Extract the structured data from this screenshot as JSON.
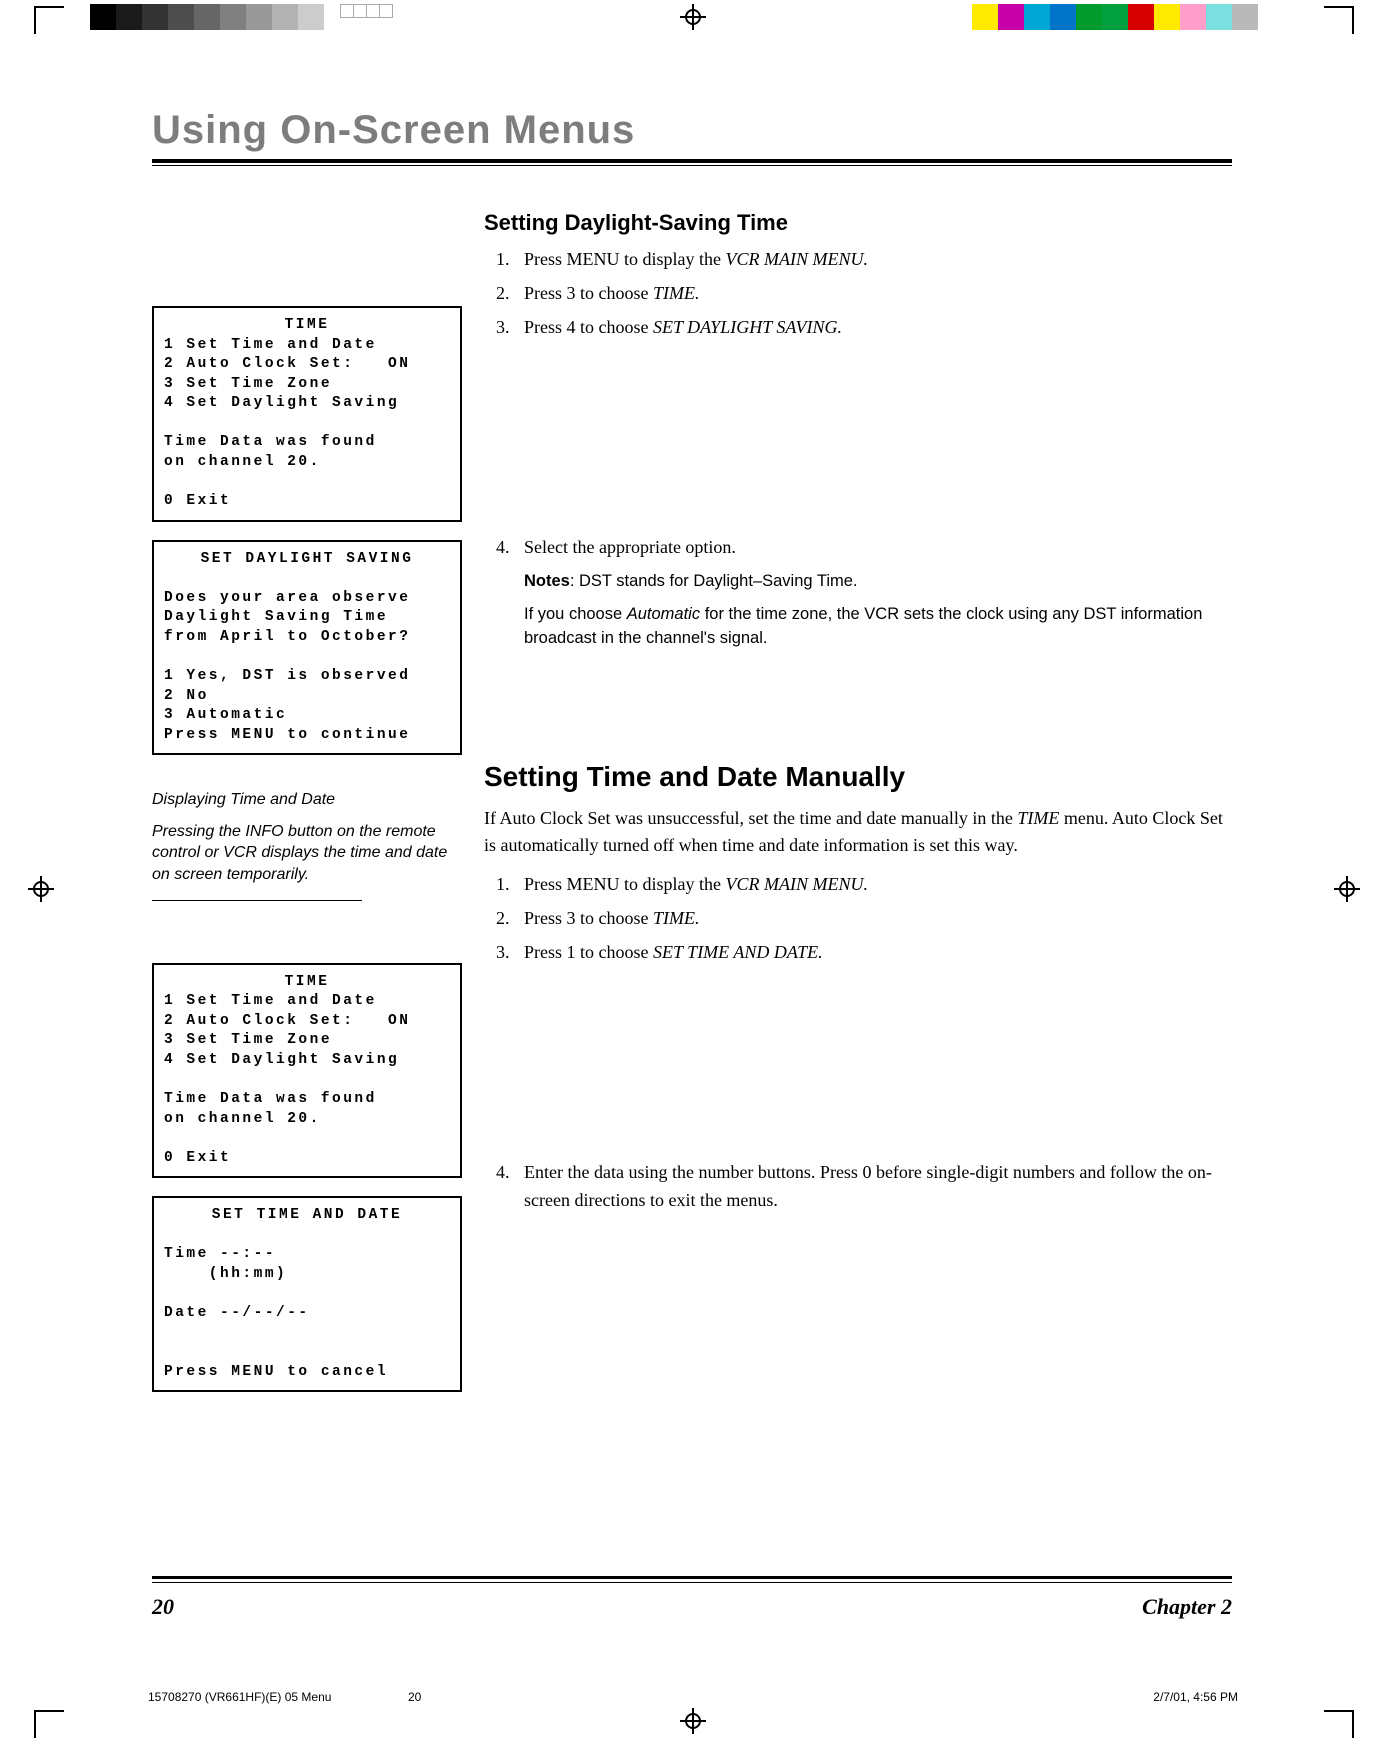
{
  "page_title": "Using On-Screen Menus",
  "section1": {
    "heading": "Setting Daylight-Saving Time",
    "step1a": "Press MENU to display the ",
    "step1b": "VCR MAIN MENU.",
    "step2a": "Press 3 to choose ",
    "step2b": "TIME.",
    "step3a": "Press 4 to choose ",
    "step3b": "SET DAYLIGHT SAVING.",
    "step4": "Select the appropriate option.",
    "notes_label": "Notes",
    "notes_a": ": DST stands for Daylight–Saving Time.",
    "notes_b1": "If you choose ",
    "notes_b2": "Automatic",
    "notes_b3": " for the time zone, the VCR sets the clock using any DST information broadcast in the channel's signal."
  },
  "sidebar_note": {
    "heading": "Displaying Time and Date",
    "body": "Pressing the INFO button on the remote control or VCR displays the time and date on screen temporarily."
  },
  "section2": {
    "heading": "Setting Time and Date Manually",
    "intro1": "If Auto Clock Set was unsuccessful, set the time and date manually in the ",
    "intro2": "TIME",
    "intro3": " menu. Auto Clock Set is automatically turned off when time and date information is set this way.",
    "step1a": "Press MENU to display the ",
    "step1b": "VCR MAIN MENU.",
    "step2a": "Press 3 to choose ",
    "step2b": "TIME.",
    "step3a": "Press 1 to choose ",
    "step3b": "SET TIME AND DATE.",
    "step4": "Enter the data using the number buttons. Press 0 before single-digit numbers and follow the on-screen directions to exit the menus."
  },
  "osd_time_title": "TIME",
  "osd_time_body": "1 Set Time and Date\n2 Auto Clock Set:   ON\n3 Set Time Zone\n4 Set Daylight Saving\n\nTime Data was found\non channel 20.\n\n0 Exit",
  "osd_dst_title": "SET DAYLIGHT SAVING",
  "osd_dst_body": "\nDoes your area observe\nDaylight Saving Time\nfrom April to October?\n\n1 Yes, DST is observed\n2 No\n3 Automatic\nPress MENU to continue",
  "osd_settime_title": "SET TIME AND DATE",
  "osd_settime_body": "\nTime --:--\n    (hh:mm)\n\nDate --/--/--\n\n\nPress MENU to cancel",
  "page_number": "20",
  "chapter_label": "Chapter 2",
  "prod_footer": {
    "doc": "15708270 (VR661HF)(E) 05 Menu",
    "page": "20",
    "date": "2/7/01, 4:56 PM"
  }
}
